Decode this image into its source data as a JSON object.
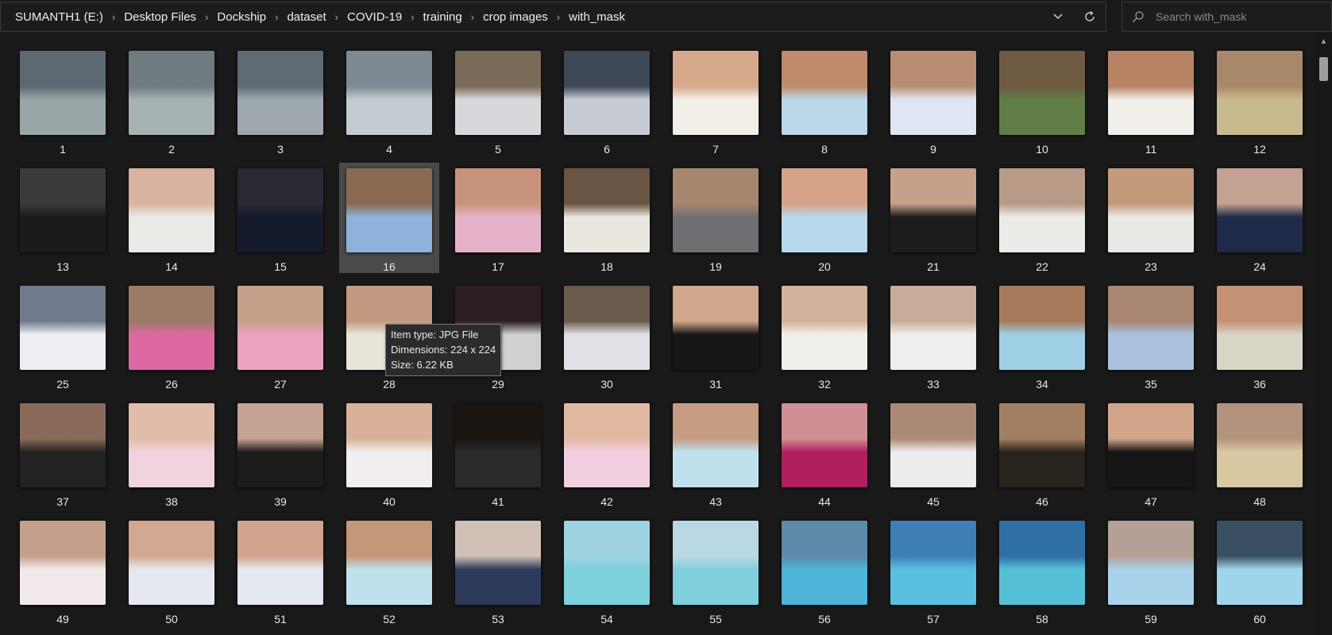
{
  "breadcrumb": [
    "SUMANTH1 (E:)",
    "Desktop Files",
    "Dockship",
    "dataset",
    "COVID-19",
    "training",
    "crop images",
    "with_mask"
  ],
  "search": {
    "placeholder": "Search with_mask",
    "value": ""
  },
  "icons": {
    "chevron_down": "chevron-down-icon",
    "refresh": "refresh-icon",
    "search": "search-icon"
  },
  "files": [
    {
      "label": "1",
      "colors": [
        "#5d6870",
        "#9aa5a8"
      ]
    },
    {
      "label": "2",
      "colors": [
        "#6f7b80",
        "#a6b1b3"
      ]
    },
    {
      "label": "3",
      "colors": [
        "#5e6a74",
        "#9ea8ae"
      ]
    },
    {
      "label": "4",
      "colors": [
        "#7d8a93",
        "#c3ccd0"
      ]
    },
    {
      "label": "5",
      "colors": [
        "#7a6a58",
        "#d8d8dc"
      ]
    },
    {
      "label": "6",
      "colors": [
        "#3d4756",
        "#c7cbd3"
      ]
    },
    {
      "label": "7",
      "colors": [
        "#d7a98b",
        "#f2efe9"
      ]
    },
    {
      "label": "8",
      "colors": [
        "#c08a6c",
        "#bcd6ea"
      ]
    },
    {
      "label": "9",
      "colors": [
        "#b98d74",
        "#dfe5f2"
      ]
    },
    {
      "label": "10",
      "colors": [
        "#6f5a44",
        "#5f7d45"
      ]
    },
    {
      "label": "11",
      "colors": [
        "#b88365",
        "#f0efe9"
      ]
    },
    {
      "label": "12",
      "colors": [
        "#a9876a",
        "#c9b98e"
      ]
    },
    {
      "label": "13",
      "colors": [
        "#3b3a3b",
        "#1b1b1b"
      ]
    },
    {
      "label": "14",
      "colors": [
        "#d9b3a1",
        "#eaeae6"
      ]
    },
    {
      "label": "15",
      "colors": [
        "#2a2a33",
        "#141a2c"
      ]
    },
    {
      "label": "16",
      "colors": [
        "#8a6a52",
        "#8eb2da"
      ]
    },
    {
      "label": "17",
      "colors": [
        "#c8937c",
        "#e6b2c9"
      ]
    },
    {
      "label": "18",
      "colors": [
        "#6a5443",
        "#e9e7e0"
      ]
    },
    {
      "label": "19",
      "colors": [
        "#a6866f",
        "#6f6f73"
      ]
    },
    {
      "label": "20",
      "colors": [
        "#d5a387",
        "#b8d8ec"
      ]
    },
    {
      "label": "21",
      "colors": [
        "#c7a08a",
        "#1c1c1e"
      ]
    },
    {
      "label": "22",
      "colors": [
        "#b89a86",
        "#ecebe8"
      ]
    },
    {
      "label": "23",
      "colors": [
        "#c39a7c",
        "#e9e8e4"
      ]
    },
    {
      "label": "24",
      "colors": [
        "#c4a192",
        "#1f2a48"
      ]
    },
    {
      "label": "25",
      "colors": [
        "#6f7a8c",
        "#eceef2"
      ]
    },
    {
      "label": "26",
      "colors": [
        "#9b7a66",
        "#dc6aa0"
      ]
    },
    {
      "label": "27",
      "colors": [
        "#c5a08a",
        "#eaa3bf"
      ]
    },
    {
      "label": "28",
      "colors": [
        "#c29a82",
        "#e7e4d8"
      ]
    },
    {
      "label": "29",
      "colors": [
        "#2c1f22",
        "#d0d0d0"
      ]
    },
    {
      "label": "30",
      "colors": [
        "#6a5a4c",
        "#dfe1e6"
      ]
    },
    {
      "label": "31",
      "colors": [
        "#d2a88c",
        "#161616"
      ]
    },
    {
      "label": "32",
      "colors": [
        "#d2b29c",
        "#f1efeb"
      ]
    },
    {
      "label": "33",
      "colors": [
        "#c7ac9a",
        "#eeeeec"
      ]
    },
    {
      "label": "34",
      "colors": [
        "#a77a5e",
        "#9fcfe4"
      ]
    },
    {
      "label": "35",
      "colors": [
        "#a98672",
        "#a9c1dd"
      ]
    },
    {
      "label": "36",
      "colors": [
        "#c49174",
        "#d8d4c6"
      ]
    },
    {
      "label": "37",
      "colors": [
        "#8a6a5a",
        "#232323"
      ]
    },
    {
      "label": "38",
      "colors": [
        "#e2bcaa",
        "#f1d3df"
      ]
    },
    {
      "label": "39",
      "colors": [
        "#c4a393",
        "#1c1c1c"
      ]
    },
    {
      "label": "40",
      "colors": [
        "#d9b09a",
        "#f1eef0"
      ]
    },
    {
      "label": "41",
      "colors": [
        "#1a1511",
        "#2a2a2a"
      ]
    },
    {
      "label": "42",
      "colors": [
        "#e1b9a3",
        "#f2cfde"
      ]
    },
    {
      "label": "43",
      "colors": [
        "#c69c83",
        "#bfe1ee"
      ]
    },
    {
      "label": "44",
      "colors": [
        "#d08f95",
        "#b0205e"
      ]
    },
    {
      "label": "45",
      "colors": [
        "#ac8a78",
        "#ececec"
      ]
    },
    {
      "label": "46",
      "colors": [
        "#a27f63",
        "#2a241f"
      ]
    },
    {
      "label": "47",
      "colors": [
        "#d2a58b",
        "#161616"
      ]
    },
    {
      "label": "48",
      "colors": [
        "#b4937e",
        "#d9c9a2"
      ]
    },
    {
      "label": "49",
      "colors": [
        "#c4a08c",
        "#f2eaea"
      ]
    },
    {
      "label": "50",
      "colors": [
        "#d3a891",
        "#e5e8f0"
      ]
    },
    {
      "label": "51",
      "colors": [
        "#d0a48d",
        "#e4e8ef"
      ]
    },
    {
      "label": "52",
      "colors": [
        "#c4967a",
        "#bfe0ec"
      ]
    },
    {
      "label": "53",
      "colors": [
        "#d0c0b6",
        "#2e3a5c"
      ]
    },
    {
      "label": "54",
      "colors": [
        "#9fd3e2",
        "#7fd1dd"
      ]
    },
    {
      "label": "55",
      "colors": [
        "#b9d8e4",
        "#7fd0dc"
      ]
    },
    {
      "label": "56",
      "colors": [
        "#5c8aa8",
        "#4fb4d8"
      ]
    },
    {
      "label": "57",
      "colors": [
        "#3d7fb6",
        "#5bbfe0"
      ]
    },
    {
      "label": "58",
      "colors": [
        "#2f6fa6",
        "#55c0d8"
      ]
    },
    {
      "label": "59",
      "colors": [
        "#b4a094",
        "#a9d3ea"
      ]
    },
    {
      "label": "60",
      "colors": [
        "#3a4f62",
        "#9fd5ea"
      ]
    }
  ],
  "selected_file": "16",
  "tooltip": {
    "type_line": "Item type: JPG File",
    "dimensions_line": "Dimensions: 224 x 224",
    "size_line": "Size: 6.22 KB"
  },
  "scrollbar": {
    "position": 0
  }
}
